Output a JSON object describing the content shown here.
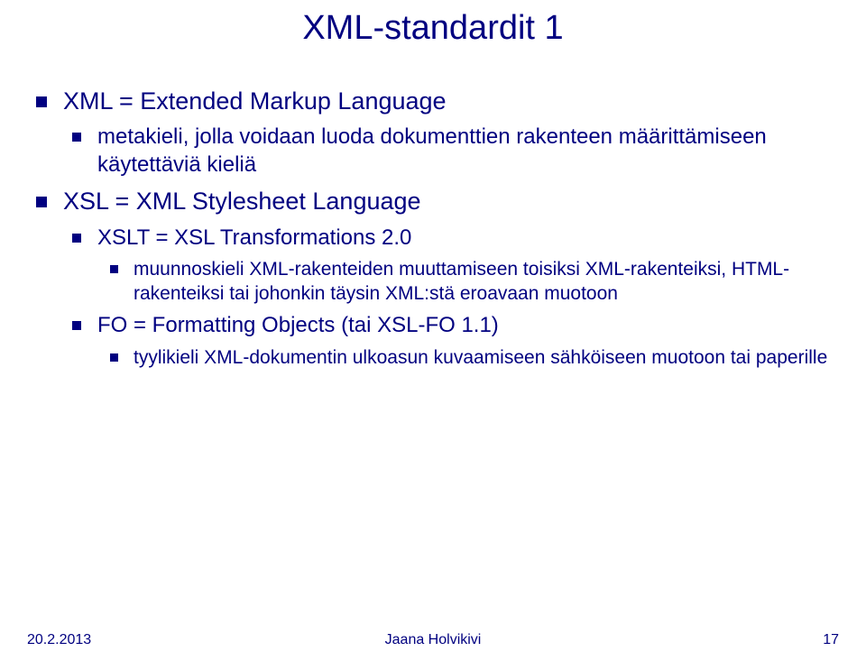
{
  "title": "XML-standardit 1",
  "bullets": {
    "b1": "XML = Extended Markup Language",
    "b1_1": "metakieli, jolla voidaan luoda dokumenttien rakenteen määrittämiseen käytettäviä kieliä",
    "b2": "XSL = XML Stylesheet Language",
    "b2_1": "XSLT = XSL Transformations 2.0",
    "b2_1_1": "muunnoskieli XML-rakenteiden muuttamiseen toisiksi XML-rakenteiksi, HTML-rakenteiksi tai johonkin täysin XML:stä eroavaan muotoon",
    "b2_2": "FO = Formatting Objects (tai XSL-FO 1.1)",
    "b2_2_1": " tyylikieli XML-dokumentin ulkoasun kuvaamiseen sähköiseen muotoon tai paperille"
  },
  "footer": {
    "date": "20.2.2013",
    "author": "Jaana Holvikivi",
    "page": "17"
  }
}
